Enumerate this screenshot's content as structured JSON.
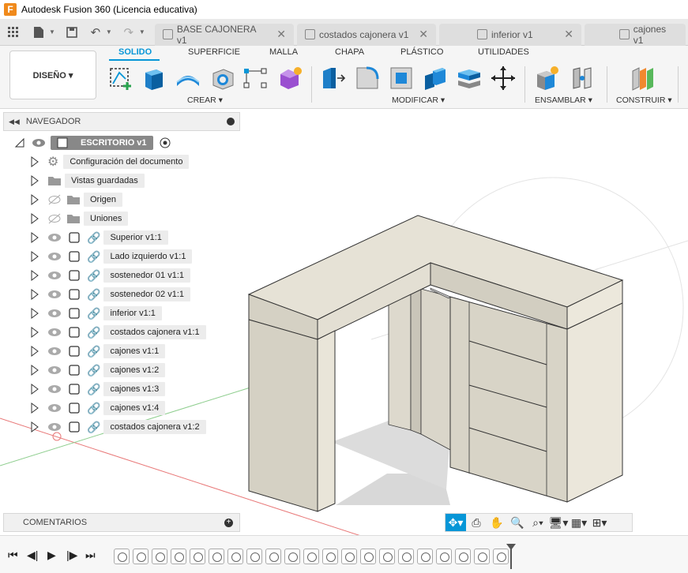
{
  "titlebar": {
    "logo_letter": "F",
    "title": "Autodesk Fusion 360 (Licencia educativa)"
  },
  "document_tabs": [
    {
      "label": "BASE CAJONERA v1",
      "closable": true
    },
    {
      "label": "costados cajonera v1",
      "closable": true
    },
    {
      "label": "inferior v1",
      "closable": true
    },
    {
      "label": "cajones v1",
      "closable": false
    }
  ],
  "toolbar": {
    "workspace_button": "DISEÑO ▾",
    "workspace_tabs": [
      "SOLIDO",
      "SUPERFICIE",
      "MALLA",
      "CHAPA",
      "PLÁSTICO",
      "UTILIDADES"
    ],
    "active_tab": "SOLIDO",
    "groups": {
      "crear": "CREAR ▾",
      "modificar": "MODIFICAR ▾",
      "ensamblar": "ENSAMBLAR ▾",
      "construir": "CONSTRUIR ▾"
    }
  },
  "navigator": {
    "title": "NAVEGADOR",
    "root": "ESCRITORIO v1",
    "items": [
      {
        "label": "Configuración del documento",
        "type": "settings"
      },
      {
        "label": "Vistas guardadas",
        "type": "folder"
      },
      {
        "label": "Origen",
        "type": "folder-hidden"
      },
      {
        "label": "Uniones",
        "type": "folder-hidden"
      },
      {
        "label": "Superior v1:1",
        "type": "component"
      },
      {
        "label": "Lado izquierdo v1:1",
        "type": "component"
      },
      {
        "label": "sostenedor 01 v1:1",
        "type": "component"
      },
      {
        "label": "sostenedor 02 v1:1",
        "type": "component"
      },
      {
        "label": "inferior v1:1",
        "type": "component"
      },
      {
        "label": "costados cajonera v1:1",
        "type": "component"
      },
      {
        "label": "cajones v1:1",
        "type": "component"
      },
      {
        "label": "cajones v1:2",
        "type": "component"
      },
      {
        "label": "cajones v1:3",
        "type": "component"
      },
      {
        "label": "cajones v1:4",
        "type": "component"
      },
      {
        "label": "costados cajonera v1:2",
        "type": "component"
      }
    ]
  },
  "comments": {
    "title": "COMENTARIOS"
  },
  "colors": {
    "accent": "#0696d7",
    "model_face": "#e6e2d6",
    "model_side": "#d0ccbf",
    "model_dark": "#b9b5a8"
  }
}
